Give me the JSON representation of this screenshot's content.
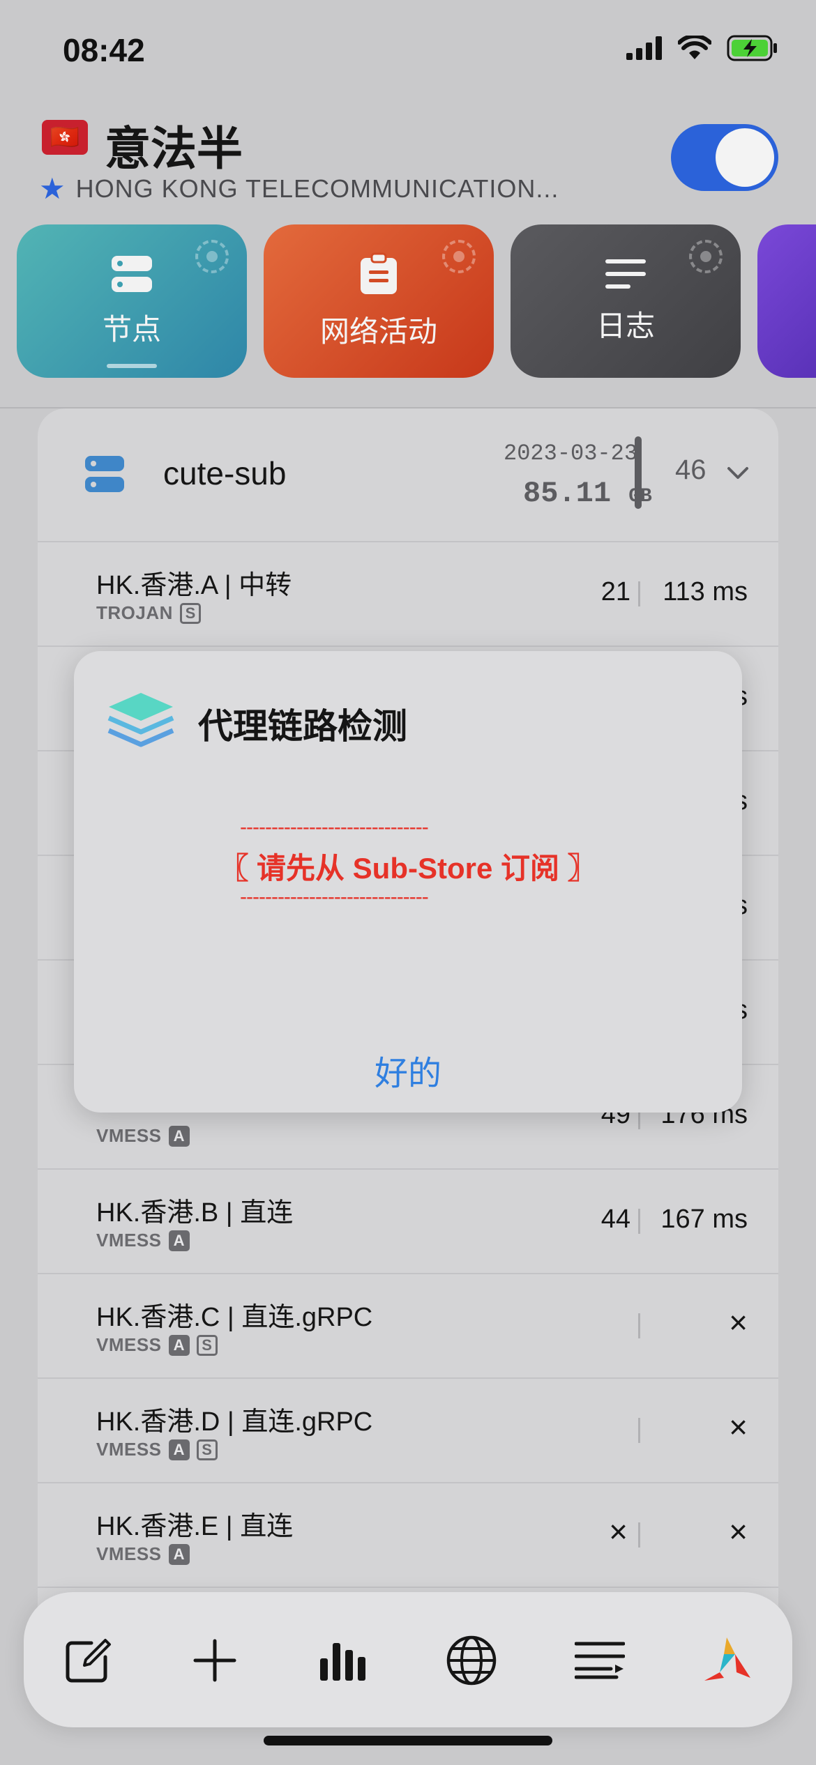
{
  "status": {
    "time": "08:42"
  },
  "header": {
    "flag": "🇭🇰",
    "title": "意法半",
    "subtitle": "HONG KONG TELECOMMUNICATION...",
    "toggle_on": true
  },
  "tiles": [
    {
      "label": "节点",
      "color": "#3c9fb0",
      "icon": "server-icon"
    },
    {
      "label": "网络活动",
      "color": "#d24a24",
      "icon": "clipboard-icon"
    },
    {
      "label": "日志",
      "color": "#555558",
      "icon": "lines-icon"
    }
  ],
  "subscription": {
    "name": "cute-sub",
    "date": "2023-03-23",
    "usage": "85.11",
    "usage_unit": "GB",
    "count": "46"
  },
  "rows": [
    {
      "name": "HK.香港.A | 中转",
      "proto": "TROJAN",
      "tags": [
        "S"
      ],
      "num": "21",
      "ms": "113 ms"
    },
    {
      "name": "",
      "proto": "VMESS",
      "tags": [
        "A"
      ],
      "num": "49",
      "ms": "176 ms"
    },
    {
      "name": "HK.香港.B | 直连",
      "proto": "VMESS",
      "tags": [
        "A"
      ],
      "num": "44",
      "ms": "167 ms"
    },
    {
      "name": "HK.香港.C | 直连.gRPC",
      "proto": "VMESS",
      "tags": [
        "A",
        "S"
      ],
      "num": "",
      "ms": "×"
    },
    {
      "name": "HK.香港.D | 直连.gRPC",
      "proto": "VMESS",
      "tags": [
        "A",
        "S"
      ],
      "num": "",
      "ms": "×"
    },
    {
      "name": "HK.香港.E | 直连",
      "proto": "VMESS",
      "tags": [
        "A"
      ],
      "num": "×",
      "ms": "×"
    }
  ],
  "dialog": {
    "title": "代理链路检测",
    "dashes": "------------------------------",
    "message": "〖 请先从 Sub-Store 订阅 〗",
    "ok": "好的"
  },
  "tabbar": {
    "items": [
      "edit-icon",
      "plus-icon",
      "chart-icon",
      "globe-icon",
      "list-icon",
      "app-logo-icon"
    ]
  }
}
